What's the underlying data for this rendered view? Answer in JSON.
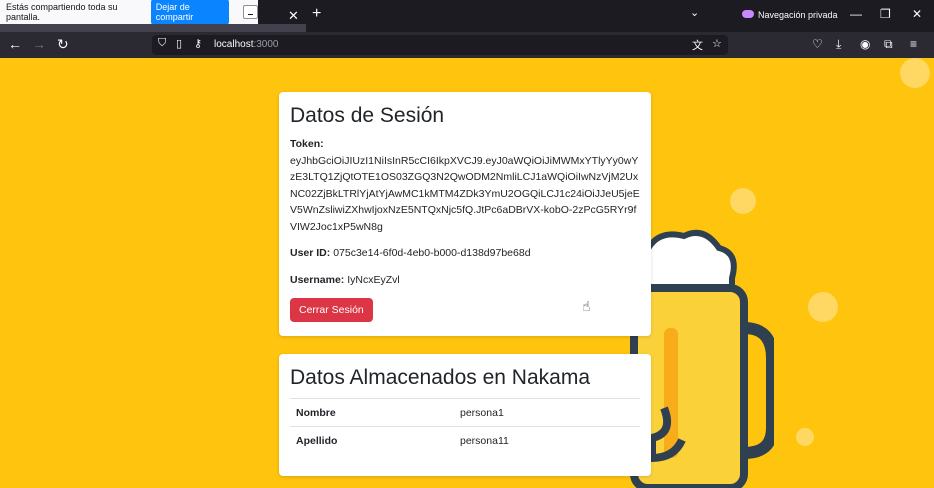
{
  "share_bar": {
    "message": "Estás compartiendo toda su pantalla.",
    "stop_label": "Dejar de compartir"
  },
  "browser": {
    "private_label": "Navegación privada",
    "url_host": "localhost",
    "url_port": ":3000"
  },
  "session_card": {
    "title": "Datos de Sesión",
    "token_label": "Token:",
    "token_value": "eyJhbGciOiJIUzI1NiIsInR5cCI6IkpXVCJ9.eyJ0aWQiOiJiMWMxYTlyYy0wYzE3LTQ1ZjQtOTE1OS03ZGQ3N2QwODM2NmliLCJ1aWQiOiIwNzVjM2UxNC02ZjBkLTRlYjAtYjAwMC1kMTM4ZDk3YmU2OGQiLCJ1c24iOiJJeU5jeEV5WnZsliwiZXhwIjoxNzE5NTQxNjc5fQ.JtPc6aDBrVX-kobO-2zPcG5RYr9fVIW2Joc1xP5wN8g",
    "user_id_label": "User ID:",
    "user_id_value": "075c3e14-6f0d-4eb0-b000-d138d97be68d",
    "username_label": "Username:",
    "username_value": "IyNcxEyZvl",
    "logout_label": "Cerrar Sesión"
  },
  "nakama_card": {
    "title": "Datos Almacenados en Nakama",
    "rows": [
      {
        "key": "Nombre",
        "value": "persona1"
      },
      {
        "key": "Apellido",
        "value": "persona11"
      }
    ]
  },
  "colors": {
    "background": "#fec40e",
    "logout_button": "#dc3545",
    "share_button": "#0a84ff"
  }
}
